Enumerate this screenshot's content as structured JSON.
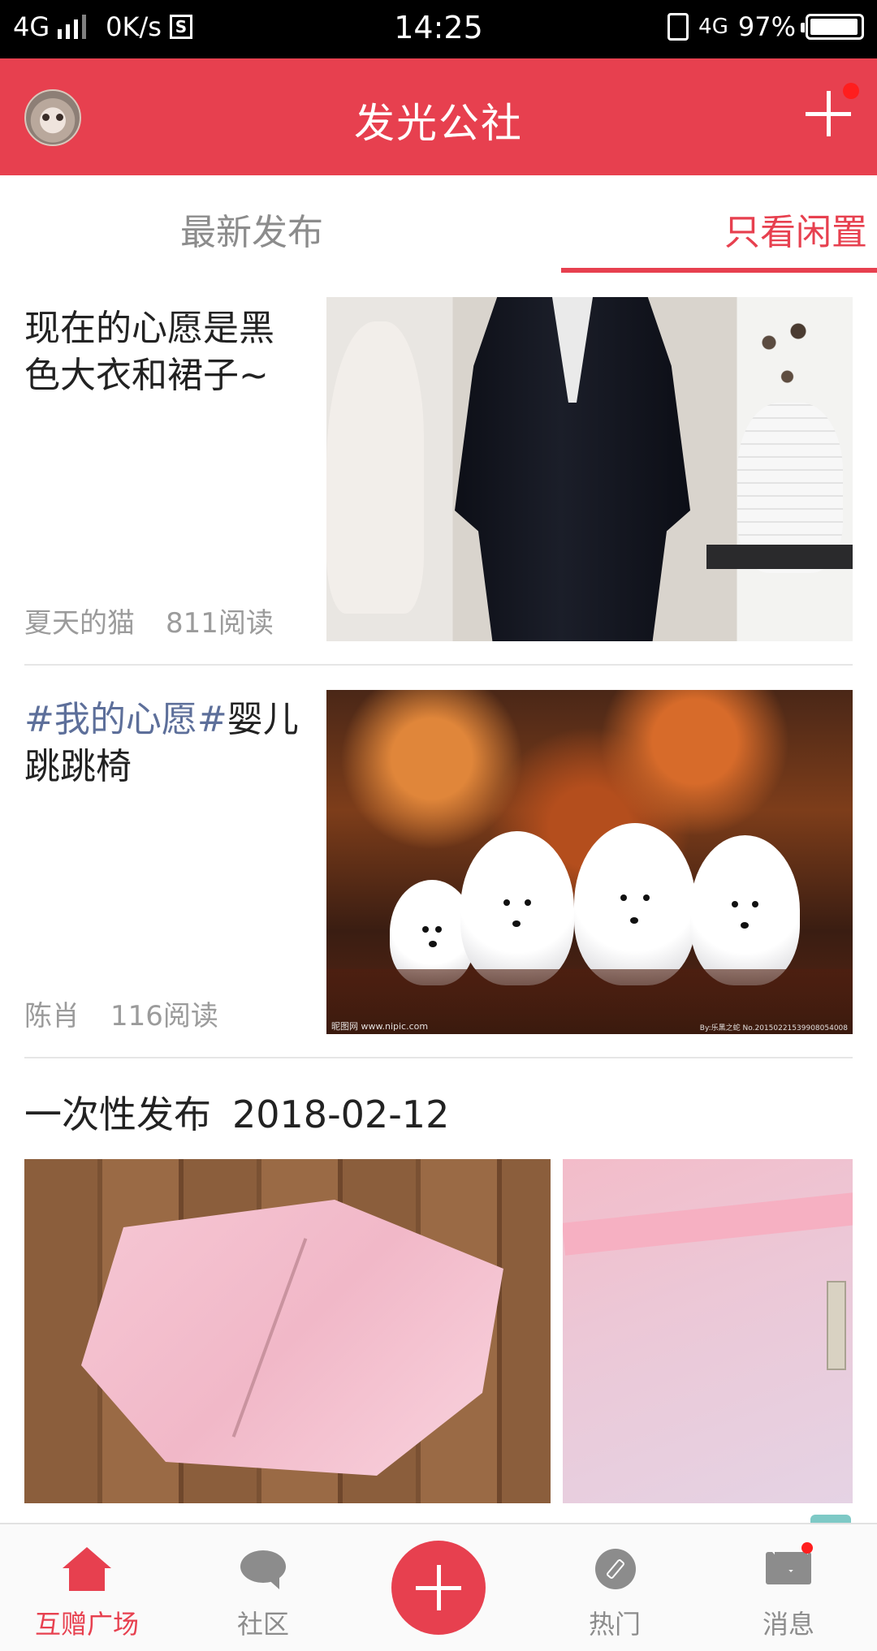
{
  "status_bar": {
    "network": "4G",
    "speed": "0K/s",
    "storage_icon": "S",
    "time": "14:25",
    "right_network": "4G",
    "battery": "97%",
    "battery_level": 0.97
  },
  "header": {
    "title": "发光公社",
    "avatar_icon": "avatar-icon",
    "action_icon": "plus-icon"
  },
  "tabs": [
    {
      "label": "最新发布",
      "active": false
    },
    {
      "label": "只看闲置",
      "active": true
    }
  ],
  "posts": [
    {
      "title": "现在的心愿是黑色大衣和裙子~",
      "tag": "",
      "author": "夏天的猫",
      "reads": "811阅读",
      "image": "black coat on hanger"
    },
    {
      "tag": "#我的心愿#",
      "title": "婴儿跳跳椅",
      "author": "陈肖",
      "reads": "116阅读",
      "image": "four white bichon dogs",
      "watermark": "昵图网 www.nipic.com",
      "watermark_id": "By:乐黑之蛇 No.20150221539908054008"
    }
  ],
  "batch": {
    "label": "一次性发布",
    "date": "2018-02-12"
  },
  "bottom_nav": [
    {
      "label": "互赠广场",
      "icon": "home-icon",
      "active": true
    },
    {
      "label": "社区",
      "icon": "chat-bubble-icon",
      "active": false
    },
    {
      "label": "",
      "icon": "plus-icon",
      "active": false
    },
    {
      "label": "热门",
      "icon": "compass-icon",
      "active": false
    },
    {
      "label": "消息",
      "icon": "mail-icon",
      "active": false
    }
  ],
  "colors": {
    "accent": "#e7404f",
    "tag": "#5d6f9a",
    "muted": "#8c8c8c"
  }
}
